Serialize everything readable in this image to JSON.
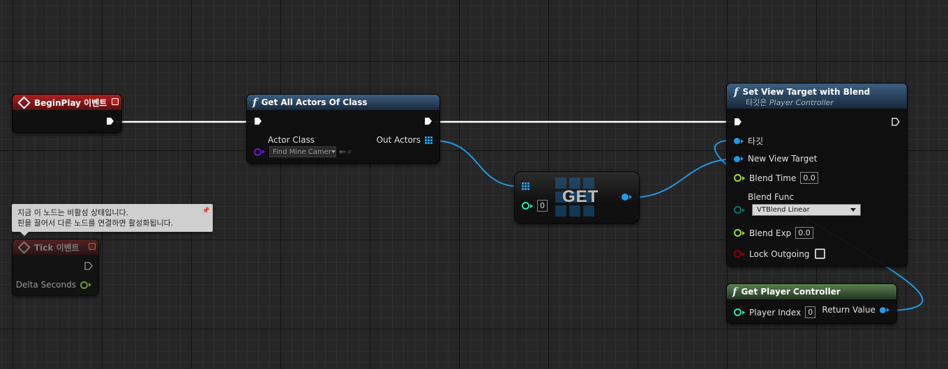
{
  "colors": {
    "exec_wire": "#ffffff",
    "object_wire": "#1e9be8",
    "int_pin": "#2ee6b0",
    "float_pin": "#9ae03c",
    "enum_pin": "#0b6e6e",
    "bool_pin": "#8b0000",
    "class_pin": "#6a1bd6"
  },
  "begin_play": {
    "title": "BeginPlay 이벤트"
  },
  "tick": {
    "title": "Tick 이벤트",
    "delta_label": "Delta Seconds"
  },
  "tooltip": {
    "line1": "지금 이 노드는 비활성 상태입니다.",
    "line2": "핀을 끌어서 다른 노드를 연결하면 활성화됩니다."
  },
  "get_all_actors": {
    "title": "Get All Actors Of Class",
    "actor_class_label": "Actor Class",
    "actor_class_value": "Find Mine Camer",
    "out_actors_label": "Out Actors"
  },
  "get_node": {
    "title": "GET",
    "index_value": "0"
  },
  "set_view_target": {
    "title": "Set View Target with Blend",
    "subtitle_prefix": "타깃은",
    "subtitle_target": "Player Controller",
    "target_label": "타깃",
    "new_view_target_label": "New View Target",
    "blend_time_label": "Blend Time",
    "blend_time_value": "0.0",
    "blend_func_label": "Blend Func",
    "blend_func_value": "VTBlend Linear",
    "blend_exp_label": "Blend Exp",
    "blend_exp_value": "0.0",
    "lock_outgoing_label": "Lock Outgoing"
  },
  "get_player_controller": {
    "title": "Get Player Controller",
    "player_index_label": "Player Index",
    "player_index_value": "0",
    "return_value_label": "Return Value"
  }
}
